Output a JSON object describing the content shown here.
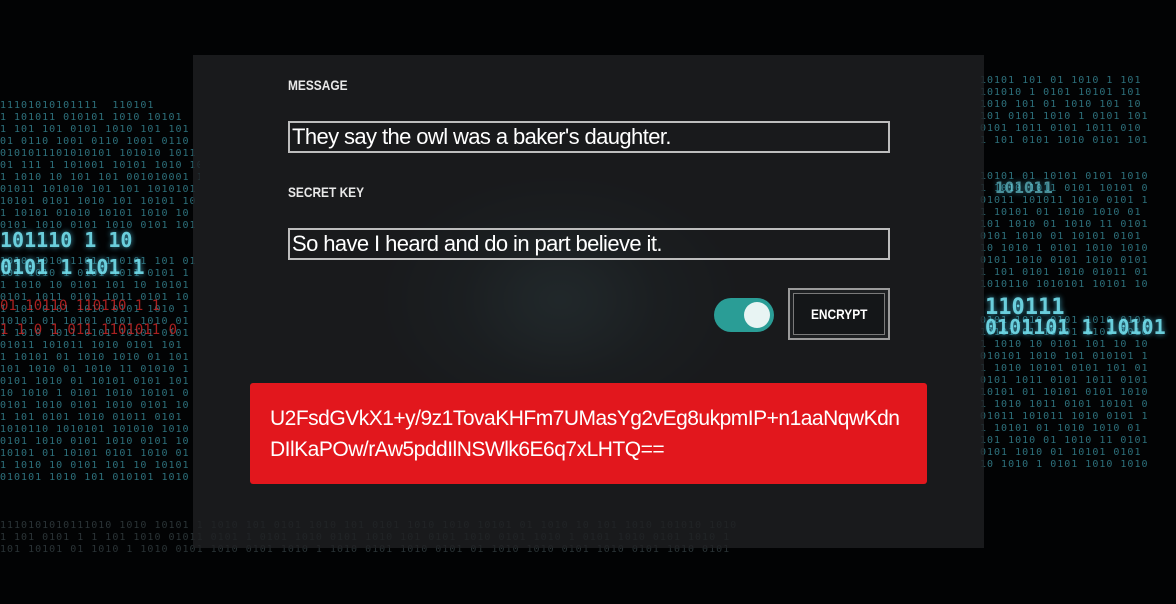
{
  "form": {
    "message_label": "MESSAGE",
    "message_value": "They say the owl was a baker's daughter.",
    "secret_key_label": "SECRET KEY",
    "secret_key_value": "So have I heard and do in part believe it.",
    "mode_toggle_on": true,
    "encrypt_label": "ENCRYPT"
  },
  "output": {
    "ciphertext": "U2FsdGVkX1+y/9z1TovaKHFm7UMasYg2vEg8ukpmIP+n1aaNqwKdnDIlKaPOw/rAw5pddIlNSWlk6E6q7xLHTQ=="
  },
  "colors": {
    "accent_teal": "#2a9d96",
    "output_red": "#e2171d",
    "panel_bg": "#1e2022"
  }
}
